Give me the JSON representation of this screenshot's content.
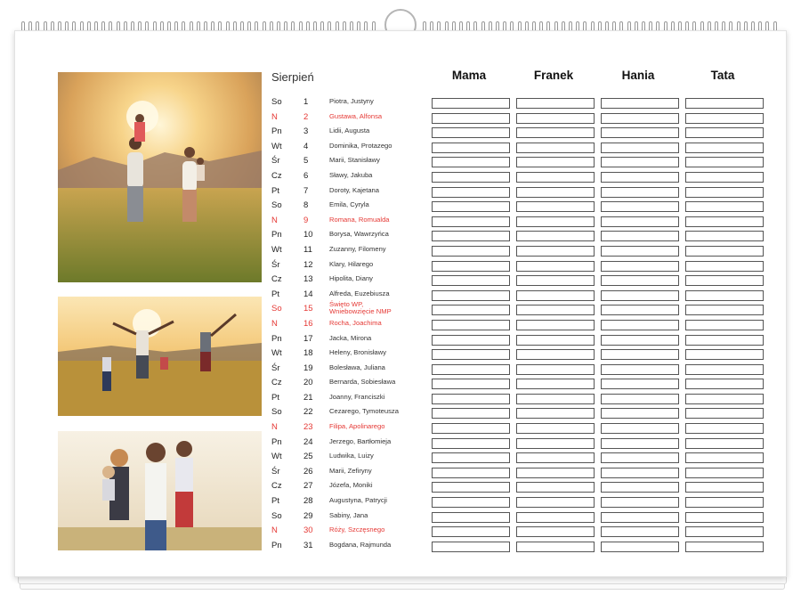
{
  "calendar": {
    "month": "Sierpień",
    "people": [
      "Mama",
      "Franek",
      "Hania",
      "Tata"
    ],
    "colors": {
      "holiday": "#e53935",
      "text": "#222222",
      "box_border": "#555555"
    },
    "days": [
      {
        "dow": "So",
        "day": "1",
        "names": "Piotra, Justyny",
        "holiday": false
      },
      {
        "dow": "N",
        "day": "2",
        "names": "Gustawa, Alfonsa",
        "holiday": true
      },
      {
        "dow": "Pn",
        "day": "3",
        "names": "Lidii, Augusta",
        "holiday": false
      },
      {
        "dow": "Wt",
        "day": "4",
        "names": "Dominika, Protazego",
        "holiday": false
      },
      {
        "dow": "Śr",
        "day": "5",
        "names": "Marii, Stanisławy",
        "holiday": false
      },
      {
        "dow": "Cz",
        "day": "6",
        "names": "Sławy, Jakuba",
        "holiday": false
      },
      {
        "dow": "Pt",
        "day": "7",
        "names": "Doroty, Kajetana",
        "holiday": false
      },
      {
        "dow": "So",
        "day": "8",
        "names": "Emila, Cyryla",
        "holiday": false
      },
      {
        "dow": "N",
        "day": "9",
        "names": "Romana, Romualda",
        "holiday": true
      },
      {
        "dow": "Pn",
        "day": "10",
        "names": "Borysa, Wawrzyńca",
        "holiday": false
      },
      {
        "dow": "Wt",
        "day": "11",
        "names": "Zuzanny, Filomeny",
        "holiday": false
      },
      {
        "dow": "Śr",
        "day": "12",
        "names": "Klary, Hilarego",
        "holiday": false
      },
      {
        "dow": "Cz",
        "day": "13",
        "names": "Hipolita, Diany",
        "holiday": false
      },
      {
        "dow": "Pt",
        "day": "14",
        "names": "Alfreda, Euzebiusza",
        "holiday": false
      },
      {
        "dow": "So",
        "day": "15",
        "names": "Święto WP,",
        "names2": "Wniebowzięcie NMP",
        "holiday": true
      },
      {
        "dow": "N",
        "day": "16",
        "names": "Rocha, Joachima",
        "holiday": true
      },
      {
        "dow": "Pn",
        "day": "17",
        "names": "Jacka, Mirona",
        "holiday": false
      },
      {
        "dow": "Wt",
        "day": "18",
        "names": "Heleny, Bronisławy",
        "holiday": false
      },
      {
        "dow": "Śr",
        "day": "19",
        "names": "Bolesława, Juliana",
        "holiday": false
      },
      {
        "dow": "Cz",
        "day": "20",
        "names": "Bernarda, Sobiesława",
        "holiday": false
      },
      {
        "dow": "Pt",
        "day": "21",
        "names": "Joanny, Franciszki",
        "holiday": false
      },
      {
        "dow": "So",
        "day": "22",
        "names": "Cezarego, Tymoteusza",
        "holiday": false
      },
      {
        "dow": "N",
        "day": "23",
        "names": "Filipa, Apolinarego",
        "holiday": true
      },
      {
        "dow": "Pn",
        "day": "24",
        "names": "Jerzego, Bartłomieja",
        "holiday": false
      },
      {
        "dow": "Wt",
        "day": "25",
        "names": "Ludwika, Luizy",
        "holiday": false
      },
      {
        "dow": "Śr",
        "day": "26",
        "names": "Marii, Zefiryny",
        "holiday": false
      },
      {
        "dow": "Cz",
        "day": "27",
        "names": "Józefa, Moniki",
        "holiday": false
      },
      {
        "dow": "Pt",
        "day": "28",
        "names": "Augustyna, Patrycji",
        "holiday": false
      },
      {
        "dow": "So",
        "day": "29",
        "names": "Sabiny, Jana",
        "holiday": false
      },
      {
        "dow": "N",
        "day": "30",
        "names": "Róży, Szczęsnego",
        "holiday": true
      },
      {
        "dow": "Pn",
        "day": "31",
        "names": "Bogdana, Rajmunda",
        "holiday": false
      }
    ]
  }
}
